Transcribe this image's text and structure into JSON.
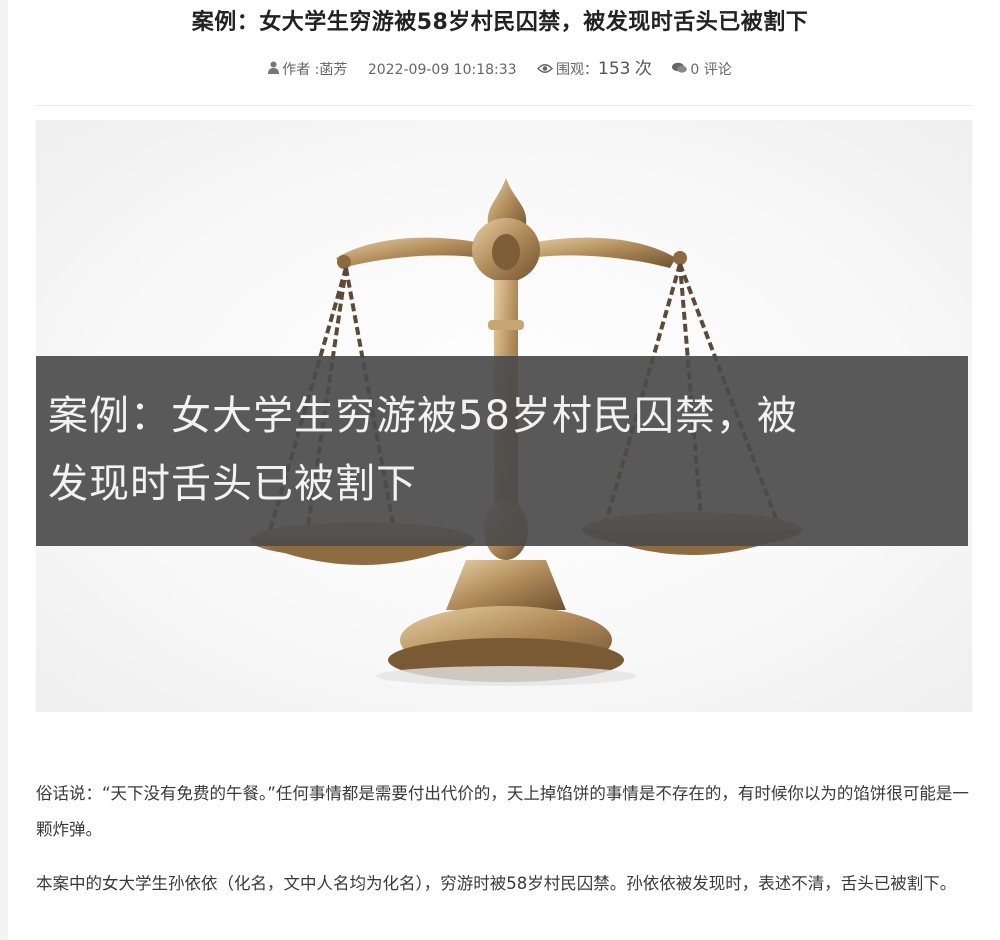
{
  "article": {
    "title": "案例：女大学生穷游被58岁村民囚禁，被发现时舌头已被割下",
    "meta": {
      "author_label": "作者 :",
      "author": "菡芳",
      "datetime": "2022-09-09 10:18:33",
      "views_label": "围观：",
      "views": "153",
      "views_unit": "次",
      "comments_count": "0",
      "comments_label": "评论",
      "icons": [
        "user-icon",
        "eye-icon",
        "comment-icon"
      ]
    },
    "hero": {
      "caption_line1": "案例：女大学生穷游被58岁村民囚禁，被",
      "caption_line2": "发现时舌头已被割下"
    },
    "paragraphs": [
      "俗话说：“天下没有免费的午餐。”任何事情都是需要付出代价的，天上掉馅饼的事情是不存在的，有时候你以为的馅饼很可能是一颗炸弹。",
      "本案中的女大学生孙依依（化名，文中人名均为化名），穷游时被58岁村民囚禁。孙依依被发现时，表述不清，舌头已被割下。"
    ]
  },
  "colors": {
    "caption_bg": "#4b4b4b",
    "brass": "#b89464"
  }
}
